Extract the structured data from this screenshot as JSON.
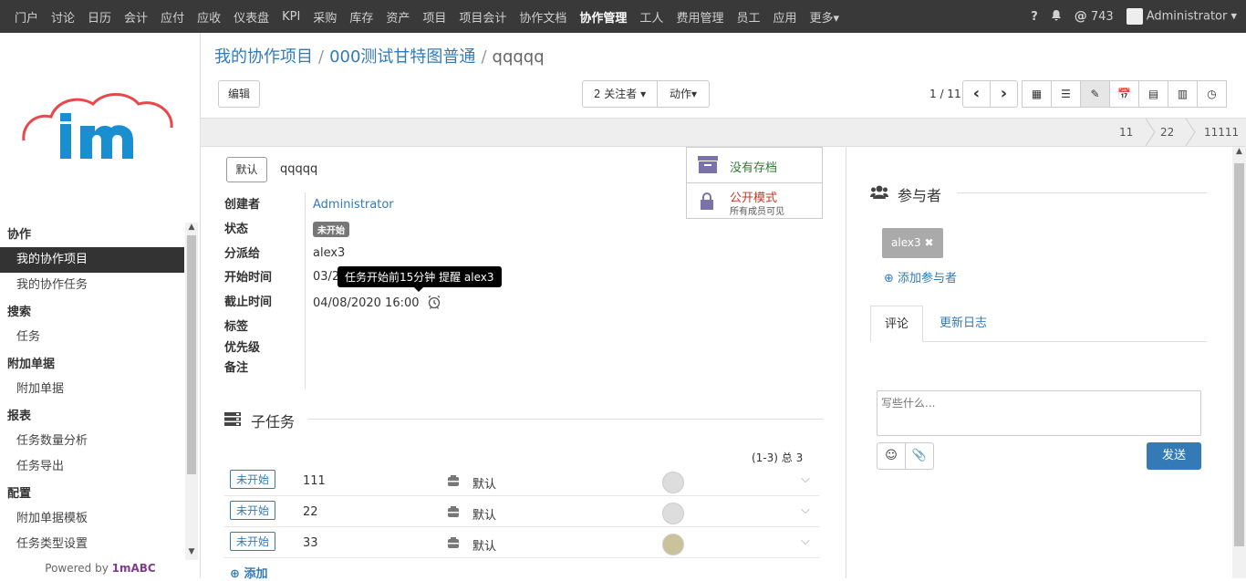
{
  "topbar": {
    "menus": [
      "门户",
      "讨论",
      "日历",
      "会计",
      "应付",
      "应收",
      "仪表盘",
      "KPI",
      "采购",
      "库存",
      "资产",
      "项目",
      "项目会计",
      "协作文档",
      "协作管理",
      "工人",
      "费用管理",
      "员工",
      "应用",
      "更多▾"
    ],
    "active_menu": "协作管理",
    "help": "?",
    "mentions": "743",
    "user": "Administrator ▾"
  },
  "sidebar": {
    "sections": [
      {
        "title": "协作",
        "items": [
          {
            "label": "我的协作项目",
            "active": true
          },
          {
            "label": "我的协作任务",
            "active": false
          }
        ]
      },
      {
        "title": "搜索",
        "items": [
          {
            "label": "任务",
            "active": false
          }
        ]
      },
      {
        "title": "附加单据",
        "items": [
          {
            "label": "附加单据",
            "active": false
          }
        ]
      },
      {
        "title": "报表",
        "items": [
          {
            "label": "任务数量分析",
            "active": false
          },
          {
            "label": "任务导出",
            "active": false
          }
        ]
      },
      {
        "title": "配置",
        "items": [
          {
            "label": "附加单据模板",
            "active": false
          },
          {
            "label": "任务类型设置",
            "active": false
          }
        ]
      }
    ],
    "powered_prefix": "Powered by ",
    "powered_brand": "1mABC",
    "colors": {
      "cloud": "#e8484b",
      "logo_blue": "#1a8fd0"
    }
  },
  "breadcrumb": {
    "items": [
      "我的协作项目",
      "000测试甘特图普通",
      "qqqqq"
    ]
  },
  "toolbar": {
    "edit": "编辑",
    "followers": "2 关注者 ▾",
    "actions": "动作▾",
    "pager": "1 / 11",
    "prev": "‹",
    "next": "›"
  },
  "stages": [
    "11",
    "22",
    "11111"
  ],
  "form": {
    "default_tag": "默认",
    "name": "qqqqq",
    "fields": [
      {
        "label": "创建者",
        "value": "Administrator"
      },
      {
        "label": "状态",
        "value": "未开始"
      },
      {
        "label": "分派给",
        "value": "alex3"
      },
      {
        "label": "开始时间",
        "value": "03/2"
      },
      {
        "label": "截止时间",
        "value": "04/08/2020 16:00"
      },
      {
        "label": "标签",
        "value": ""
      },
      {
        "label": "优先级",
        "value": ""
      },
      {
        "label": "备注",
        "value": ""
      }
    ],
    "tooltip": "任务开始前15分钟 提醒 alex3",
    "smart": {
      "archive": "没有存档",
      "privacy_title": "公开模式",
      "privacy_sub": "所有成员可见"
    }
  },
  "subtasks": {
    "title": "子任务",
    "pager": "(1-3) 总 3",
    "rows": [
      {
        "status": "未开始",
        "name": "111",
        "type": "默认"
      },
      {
        "status": "未开始",
        "name": "22",
        "type": "默认"
      },
      {
        "status": "未开始",
        "name": "33",
        "type": "默认"
      }
    ],
    "add": "添加"
  },
  "right": {
    "participants_title": "参与者",
    "participant": "alex3",
    "add_participant": "添加参与者",
    "tabs": [
      "评论",
      "更新日志"
    ],
    "placeholder": "写些什么...",
    "send": "发送"
  }
}
